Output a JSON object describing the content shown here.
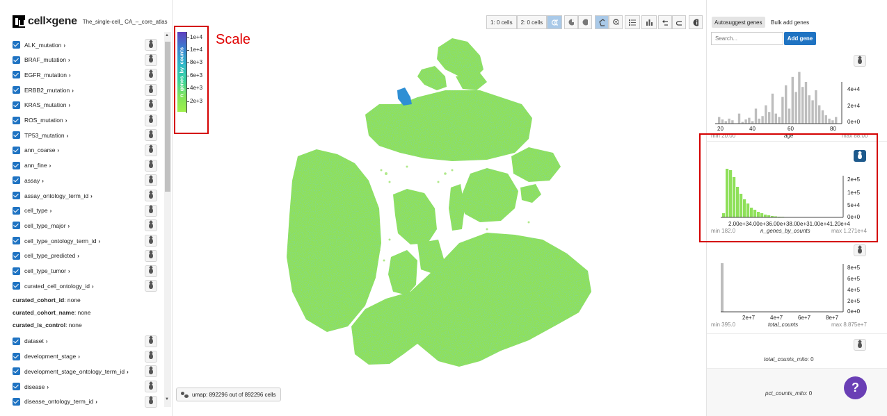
{
  "brand": {
    "name": "cell×gene",
    "dataset": "The_single-cell_ CA_–_core_atlas"
  },
  "sidebar": {
    "categories_top": [
      {
        "label": "ALK_mutation"
      },
      {
        "label": "BRAF_mutation"
      },
      {
        "label": "EGFR_mutation"
      },
      {
        "label": "ERBB2_mutation"
      },
      {
        "label": "KRAS_mutation"
      },
      {
        "label": "ROS_mutation"
      },
      {
        "label": "TP53_mutation"
      },
      {
        "label": "ann_coarse"
      },
      {
        "label": "ann_fine"
      },
      {
        "label": "assay"
      },
      {
        "label": "assay_ontology_term_id"
      },
      {
        "label": "cell_type"
      },
      {
        "label": "cell_type_major"
      },
      {
        "label": "cell_type_ontology_term_id"
      },
      {
        "label": "cell_type_predicted"
      },
      {
        "label": "cell_type_tumor"
      },
      {
        "label": "curated_cell_ontology_id"
      }
    ],
    "metadata": [
      {
        "key": "curated_cohort_id",
        "value": ": none"
      },
      {
        "key": "curated_cohort_name",
        "value": ": none"
      },
      {
        "key": "curated_is_control",
        "value": ": none"
      }
    ],
    "categories_bottom": [
      {
        "label": "dataset"
      },
      {
        "label": "development_stage"
      },
      {
        "label": "development_stage_ontology_term_id"
      },
      {
        "label": "disease"
      },
      {
        "label": "disease_ontology_term_id"
      }
    ]
  },
  "toolbar": {
    "cells1": "1: 0 cells",
    "cells2": "2: 0 cells"
  },
  "legend": {
    "title": "n_genes_by_counts",
    "ticks": [
      "1e+4",
      "1e+4",
      "8e+3",
      "6e+3",
      "4e+3",
      "2e+3"
    ],
    "annotation": "Scale",
    "colors": [
      "#5e3fbe",
      "#3b7fd0",
      "#2bb5c8",
      "#34d29c",
      "#7ee35a",
      "#9ef04c"
    ]
  },
  "status": {
    "umap": "umap: 892296 out of 892296 cells"
  },
  "right_panel": {
    "tabs": {
      "autosuggest": "Autosuggest genes",
      "bulk": "Bulk add genes"
    },
    "search": {
      "placeholder": "Search..."
    },
    "add_gene": "Add gene",
    "age": {
      "name": "age",
      "min": "min 20.00",
      "max": "max 88.00",
      "x_ticks": [
        "20",
        "40",
        "60",
        "80"
      ],
      "y_ticks": [
        "4e+4",
        "2e+4",
        "0e+0"
      ]
    },
    "n_genes": {
      "name": "n_genes_by_counts",
      "min": "min 182.0",
      "max": "max 1.271e+4",
      "x_ticks": "2.00e+34.00e+36.00e+38.00e+31.00e+41.20e+4",
      "y_ticks": [
        "2e+5",
        "1e+5",
        "5e+4",
        "0e+0"
      ]
    },
    "total_counts": {
      "name": "total_counts",
      "min": "min 395.0",
      "max": "max 8.875e+7",
      "x_ticks": [
        "2e+7",
        "4e+7",
        "6e+7",
        "8e+7"
      ],
      "y_ticks": [
        "8e+5",
        "6e+5",
        "4e+5",
        "2e+5",
        "0e+0"
      ]
    },
    "mito_counts": {
      "name": "total_counts_mito",
      "value": ": 0"
    },
    "pct_mito": {
      "name": "pct_counts_mito",
      "value": ": 0"
    }
  },
  "help": "?"
}
